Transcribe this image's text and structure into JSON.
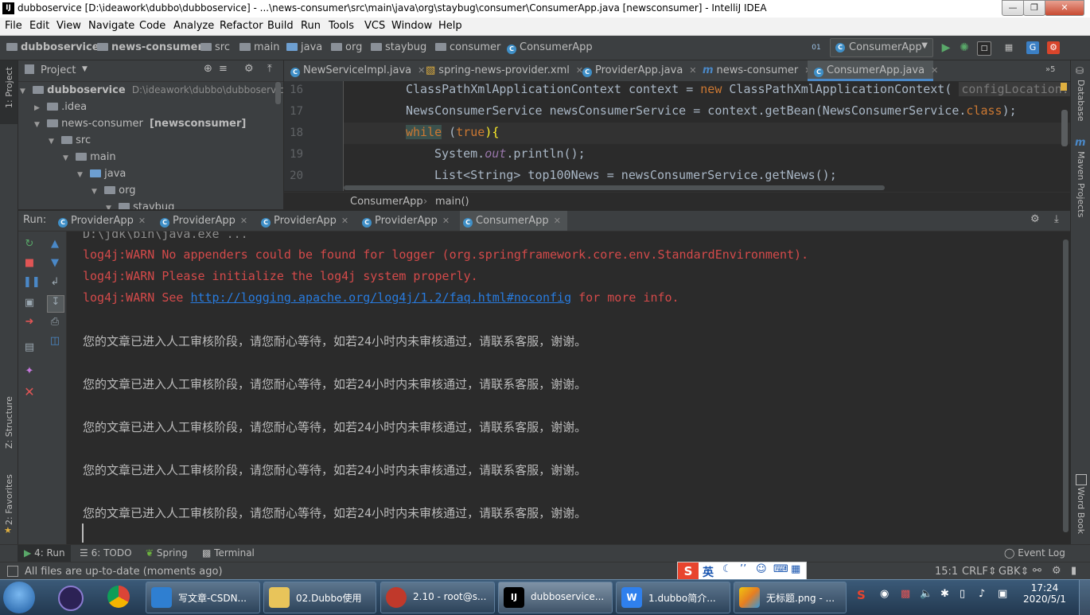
{
  "window": {
    "title": "dubboservice [D:\\ideawork\\dubbo\\dubboservice] - ...\\news-consumer\\src\\main\\java\\org\\staybug\\consumer\\ConsumerApp.java [newsconsumer] - IntelliJ IDEA",
    "app_icon": "IJ"
  },
  "menu": [
    "File",
    "Edit",
    "View",
    "Navigate",
    "Code",
    "Analyze",
    "Refactor",
    "Build",
    "Run",
    "Tools",
    "VCS",
    "Window",
    "Help"
  ],
  "navbar": {
    "crumbs": [
      "dubboservice",
      "news-consumer",
      "src",
      "main",
      "java",
      "org",
      "staybug",
      "consumer",
      "ConsumerApp"
    ],
    "run_config": "ConsumerApp"
  },
  "project": {
    "header": "Project",
    "tree": [
      {
        "label": "dubboservice",
        "extra": "D:\\ideawork\\dubbo\\dubboservice",
        "bold": true
      },
      {
        "label": ".idea"
      },
      {
        "label": "news-consumer",
        "extra": "[newsconsumer]"
      },
      {
        "label": "src"
      },
      {
        "label": "main"
      },
      {
        "label": "java"
      },
      {
        "label": "org"
      },
      {
        "label": "staybug"
      }
    ]
  },
  "editor_tabs": [
    "NewServiceImpl.java",
    "spring-news-provider.xml",
    "ProviderApp.java",
    "news-consumer",
    "ConsumerApp.java"
  ],
  "editor_tabs_overflow": "5",
  "editor": {
    "line_numbers": [
      "16",
      "17",
      "18",
      "19",
      "20"
    ],
    "lines": {
      "l16_a": "ClassPathXmlApplicationContext context = ",
      "l16_kw": "new",
      "l16_b": " ClassPathXmlApplicationContext( ",
      "l16_hint": "configLocation:",
      "l17_a": "NewsConsumerService newsConsumerService = context.getBean(NewsConsumerService.",
      "l17_kw": "class",
      "l17_b": ");",
      "l18_kw": "while",
      "l18_b": " (",
      "l18_kw2": "true",
      "l18_c": "){",
      "l19_a": "System.",
      "l19_fld": "out",
      "l19_b": ".println();",
      "l20_a": "List<String> top100News = newsConsumerService.getNews();"
    },
    "breadcrumb": [
      "ConsumerApp",
      "main()"
    ]
  },
  "run": {
    "label": "Run:",
    "tabs": [
      "ProviderApp",
      "ProviderApp",
      "ProviderApp",
      "ProviderApp",
      "ConsumerApp"
    ],
    "console": {
      "cmd": "D:\\jdk\\bin\\java.exe ...",
      "warn1": "log4j:WARN No appenders could be found for logger (org.springframework.core.env.StandardEnvironment).",
      "warn2": "log4j:WARN Please initialize the log4j system properly.",
      "warn3_a": "log4j:WARN See ",
      "warn3_link": "http://logging.apache.org/log4j/1.2/faq.html#noconfig",
      "warn3_b": " for more info.",
      "messages": [
        "您的文章已进入人工审核阶段，请您耐心等待，如若24小时内未审核通过，请联系客服，谢谢。",
        "您的文章已进入人工审核阶段，请您耐心等待，如若24小时内未审核通过，请联系客服，谢谢。",
        "您的文章已进入人工审核阶段，请您耐心等待，如若24小时内未审核通过，请联系客服，谢谢。",
        "您的文章已进入人工审核阶段，请您耐心等待，如若24小时内未审核通过，请联系客服，谢谢。",
        "您的文章已进入人工审核阶段，请您耐心等待，如若24小时内未审核通过，请联系客服，谢谢。"
      ]
    }
  },
  "side_stripes": {
    "left_top": "1: Project",
    "left_mid": "Z: Structure",
    "left_bottom": "2: Favorites",
    "right_top": "Database",
    "right_mid": "Maven Projects",
    "right_bottom": "Word Book"
  },
  "bottom_tabs": {
    "run": "4: Run",
    "todo": "6: TODO",
    "spring": "Spring",
    "terminal": "Terminal",
    "event_log": "Event Log"
  },
  "status": {
    "message": "All files are up-to-date (moments ago)",
    "position": "15:1",
    "line_sep": "CRLF",
    "encoding": "GBK",
    "ime_label": "英"
  },
  "taskbar": {
    "tasks": [
      "写文章-CSDN...",
      "02.Dubbo使用",
      "2.10 - root@s...",
      "dubboservice...",
      "1.dubbo简介...",
      "无标题.png - ..."
    ],
    "clock_time": "17:24",
    "clock_date": "2020/5/1"
  },
  "colors": {
    "accent": "#4a88c7",
    "warn": "#d44a4a",
    "link": "#287bde",
    "keyword": "#cc7832"
  }
}
